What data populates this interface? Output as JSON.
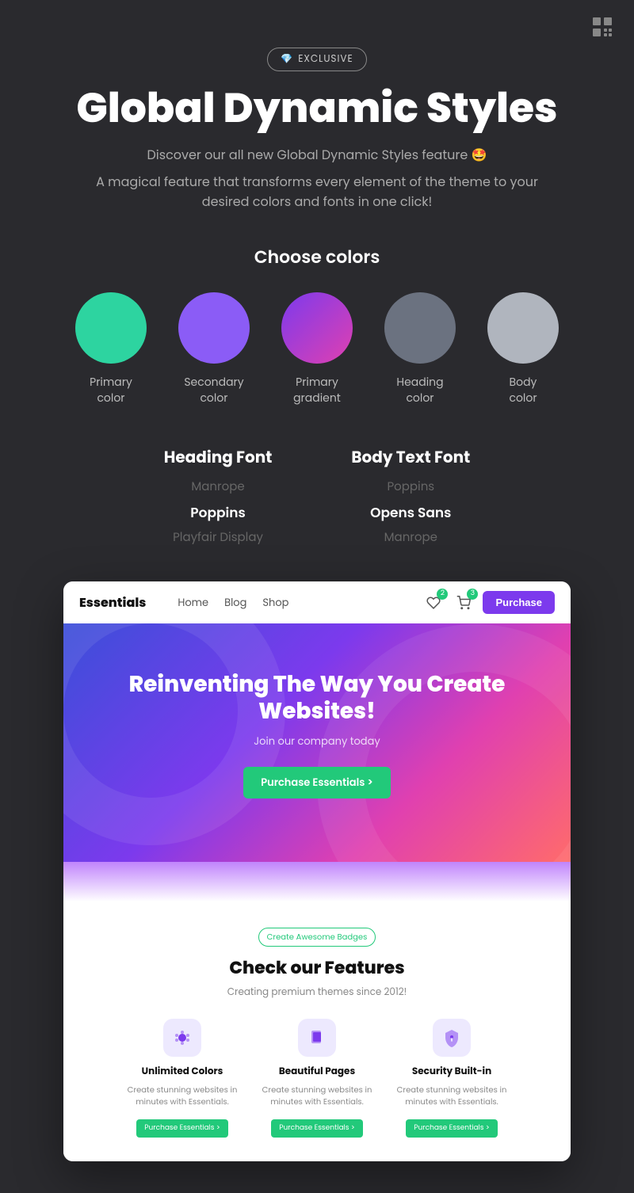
{
  "topbar": {
    "icon_label": "brand-icon"
  },
  "hero": {
    "badge_icon": "💎",
    "badge_text": "EXCLUSIVE",
    "title": "Global Dynamic Styles",
    "subtitle1": "Discover our all new Global Dynamic Styles feature 🤩",
    "subtitle2": "A magical feature that transforms every element of the theme to your desired colors and fonts in one click!"
  },
  "colors": {
    "heading": "Choose colors",
    "swatches": [
      {
        "id": "primary",
        "label": "Primary\ncolor",
        "bg": "#2dd4a0",
        "type": "solid"
      },
      {
        "id": "secondary",
        "label": "Secondary\ncolor",
        "bg": "#8b5cf6",
        "type": "solid"
      },
      {
        "id": "primary-gradient",
        "label": "Primary\ngradient",
        "bg": "linear-gradient(135deg, #7c3aed, #e040b0)",
        "type": "gradient"
      },
      {
        "id": "heading",
        "label": "Heading\ncolor",
        "bg": "#6b7280",
        "type": "solid"
      },
      {
        "id": "body",
        "label": "Body\ncolor",
        "bg": "#b0b5be",
        "type": "solid"
      }
    ]
  },
  "fonts": {
    "heading_font": {
      "label": "Heading Font",
      "options": [
        {
          "name": "Manrope",
          "active": false
        },
        {
          "name": "Poppins",
          "active": true
        },
        {
          "name": "Playfair Display",
          "active": false
        }
      ]
    },
    "body_font": {
      "label": "Body Text Font",
      "options": [
        {
          "name": "Poppins",
          "active": false
        },
        {
          "name": "Opens Sans",
          "active": true
        },
        {
          "name": "Manrope",
          "active": false
        }
      ]
    }
  },
  "preview": {
    "nav": {
      "brand": "Essentials",
      "links": [
        "Home",
        "Blog",
        "Shop"
      ],
      "wishlist_count": "2",
      "cart_count": "3",
      "cta": "Purchase"
    },
    "hero": {
      "title": "Reinventing The Way You Create Websites!",
      "subtitle": "Join our company today",
      "cta": "Purchase Essentials >"
    },
    "features_badge": "Create Awesome Badges",
    "features_title": "Check our Features",
    "features_subtitle": "Creating premium themes since 2012!",
    "feature_cards": [
      {
        "icon": "🔮",
        "icon_bg": "#ede9fe",
        "title": "Unlimited Colors",
        "desc": "Create stunning websites in minutes with Essentials.",
        "cta": "Purchase Essentials >"
      },
      {
        "icon": "📄",
        "icon_bg": "#ede9fe",
        "title": "Beautiful Pages",
        "desc": "Create stunning websites in minutes with Essentials.",
        "cta": "Purchase Essentials >"
      },
      {
        "icon": "🔒",
        "icon_bg": "#ede9fe",
        "title": "Security Built-in",
        "desc": "Create stunning websites in minutes with Essentials.",
        "cta": "Purchase Essentials >"
      }
    ]
  }
}
